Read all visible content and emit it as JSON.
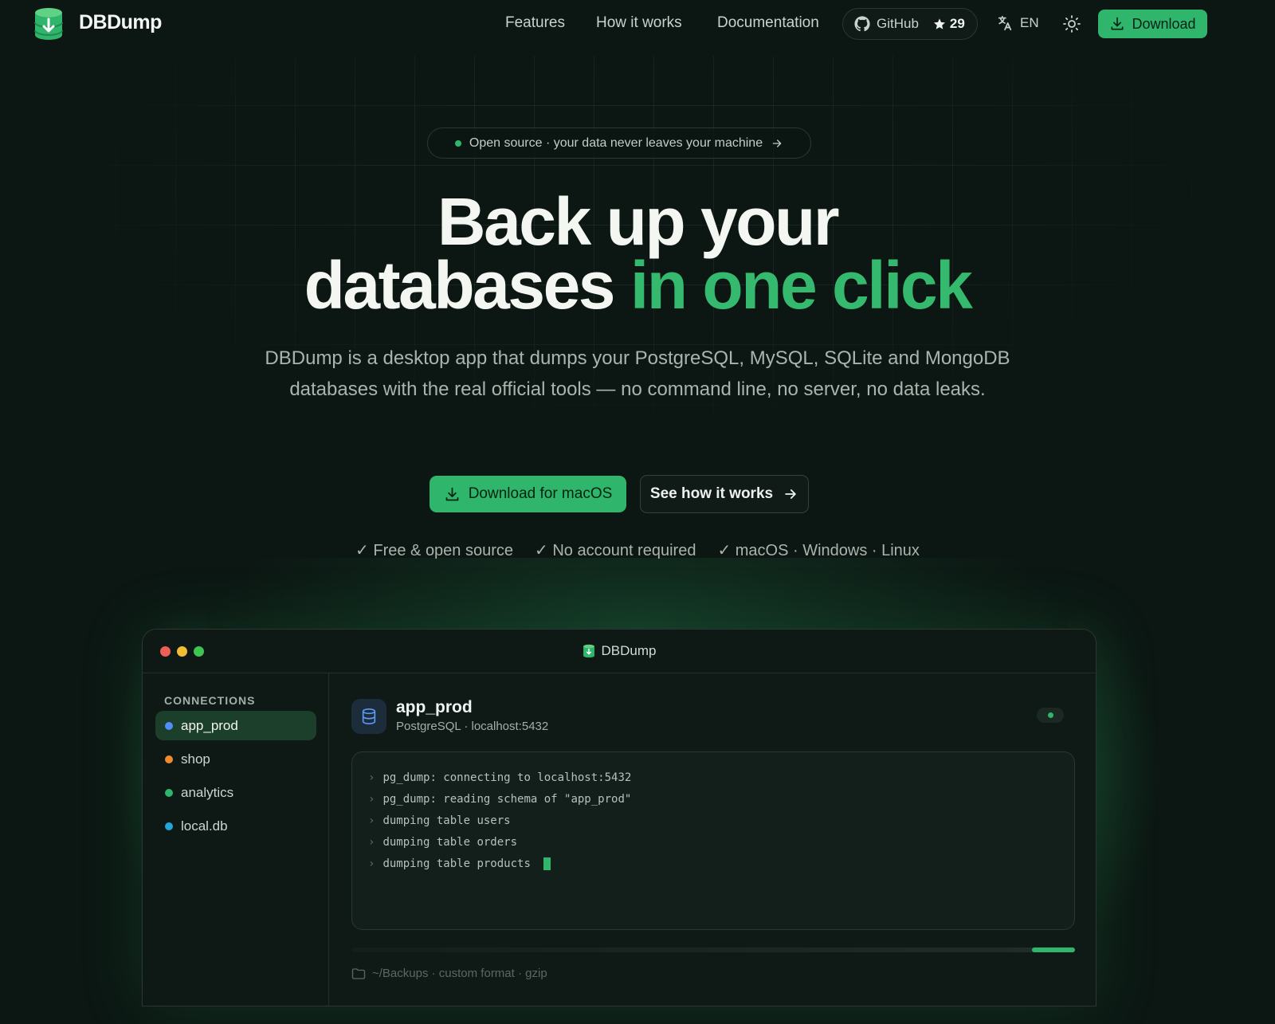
{
  "nav": {
    "brand": "DBDump",
    "links": [
      "Features",
      "How it works",
      "Documentation"
    ],
    "github_label": "GitHub",
    "github_stars": "29",
    "language": "EN",
    "download_label": "Download"
  },
  "hero": {
    "badge": "Open source · your data never leaves your machine",
    "title_line1": "Back up your",
    "title_line2_plain": "databases ",
    "title_line2_accent": "in one click",
    "lead": "DBDump is a desktop app that dumps your PostgreSQL, MySQL, SQLite and MongoDB databases with the real official tools — no command line, no server, no data leaks.",
    "cta_primary": "Download for macOS",
    "cta_secondary": "See how it works",
    "checks": [
      "✓ Free & open source",
      "✓ No account required",
      "✓ macOS · Windows · Linux"
    ]
  },
  "app": {
    "window_title": "DBDump",
    "connections_heading": "CONNECTIONS",
    "connections": [
      {
        "name": "app_prod",
        "color": "#4f8ff7",
        "active": true
      },
      {
        "name": "shop",
        "color": "#f08a2c",
        "active": false
      },
      {
        "name": "analytics",
        "color": "#2fb56c",
        "active": false
      },
      {
        "name": "local.db",
        "color": "#22a7d9",
        "active": false
      }
    ],
    "db_name": "app_prod",
    "db_meta": "PostgreSQL · localhost:5432",
    "log": [
      "pg_dump: connecting to localhost:5432",
      "pg_dump: reading schema of \"app_prod\"",
      "dumping table users",
      "dumping table orders",
      "dumping table products"
    ],
    "progress": 0.06,
    "footnote": "~/Backups · custom format · gzip"
  },
  "colors": {
    "accent": "#2fb56c",
    "background": "#0c1713"
  }
}
